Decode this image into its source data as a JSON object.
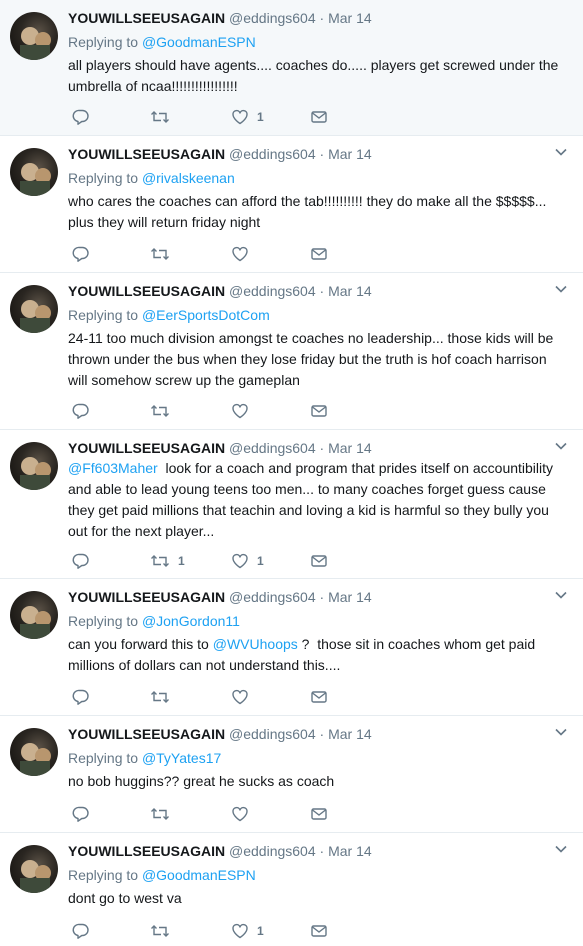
{
  "colors": {
    "link": "#1da1f2",
    "muted": "#657786",
    "text": "#14171a",
    "highlight_bg": "#f5f8fa",
    "divider": "#e6ecf0"
  },
  "icons": [
    "avatar",
    "caret-down-icon",
    "reply-icon",
    "retweet-icon",
    "like-icon",
    "direct-message-icon"
  ],
  "tweets": [
    {
      "fullname": "YOUWILLSEEUSAGAIN",
      "username": "@eddings604",
      "separator": "·",
      "time": "Mar 14",
      "replying_prefix": "Replying to ",
      "replying_to": "@GoodmanESPN",
      "text": "all players should have agents.... coaches do..... players get screwed under the umbrella of ncaa!!!!!!!!!!!!!!!!!",
      "retweets": "",
      "likes": "1"
    },
    {
      "fullname": "YOUWILLSEEUSAGAIN",
      "username": "@eddings604",
      "separator": "·",
      "time": "Mar 14",
      "replying_prefix": "Replying to ",
      "replying_to": "@rivalskeenan",
      "text": "who cares the coaches can afford the tab!!!!!!!!!!  they do make all the $$$$$... plus they will return friday night",
      "retweets": "",
      "likes": ""
    },
    {
      "fullname": "YOUWILLSEEUSAGAIN",
      "username": "@eddings604",
      "separator": "·",
      "time": "Mar 14",
      "replying_prefix": "Replying to ",
      "replying_to": "@EerSportsDotCom",
      "text": "24-11   too much division amongst te coaches no leadership... those kids will be thrown under the bus when they lose friday but the truth is hof coach harrison will somehow screw up the gameplan",
      "retweets": "",
      "likes": ""
    },
    {
      "fullname": "YOUWILLSEEUSAGAIN",
      "username": "@eddings604",
      "separator": "·",
      "time": "Mar 14",
      "leading_mention": "@Ff603Maher",
      "text": "  look for a coach and program that prides itself on accountibility and able to lead young teens too men... to many coaches forget guess cause they get paid millions that teachin and loving a kid is harmful so they bully you out for the next player...",
      "retweets": "1",
      "likes": "1"
    },
    {
      "fullname": "YOUWILLSEEUSAGAIN",
      "username": "@eddings604",
      "separator": "·",
      "time": "Mar 14",
      "replying_prefix": "Replying to ",
      "replying_to": "@JonGordon11",
      "text_before": "can you forward this to ",
      "inline_mention": "@WVUhoops",
      "text_after": " ?  those sit in coaches whom get paid millions of dollars can not understand this....",
      "retweets": "",
      "likes": ""
    },
    {
      "fullname": "YOUWILLSEEUSAGAIN",
      "username": "@eddings604",
      "separator": "·",
      "time": "Mar 14",
      "replying_prefix": "Replying to ",
      "replying_to": "@TyYates17",
      "text": "no bob huggins??  great he sucks as coach",
      "retweets": "",
      "likes": ""
    },
    {
      "fullname": "YOUWILLSEEUSAGAIN",
      "username": "@eddings604",
      "separator": "·",
      "time": "Mar 14",
      "replying_prefix": "Replying to ",
      "replying_to": "@GoodmanESPN",
      "text": "dont go to west va",
      "retweets": "",
      "likes": "1"
    }
  ]
}
